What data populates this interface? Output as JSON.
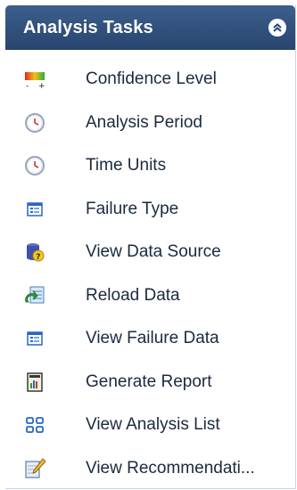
{
  "panel": {
    "title": "Analysis Tasks",
    "collapse_icon": "double-chevron-up-icon",
    "colors": {
      "header": "#2e4f7c",
      "text": "#1b2a3f"
    }
  },
  "tasks": [
    {
      "label": "Confidence Level",
      "icon": "confidence-level-icon"
    },
    {
      "label": "Analysis Period",
      "icon": "clock-icon"
    },
    {
      "label": "Time Units",
      "icon": "clock-icon"
    },
    {
      "label": "Failure Type",
      "icon": "form-icon"
    },
    {
      "label": "View Data Source",
      "icon": "data-source-icon"
    },
    {
      "label": "Reload Data",
      "icon": "reload-data-icon"
    },
    {
      "label": "View Failure Data",
      "icon": "form-icon"
    },
    {
      "label": "Generate Report",
      "icon": "report-icon"
    },
    {
      "label": "View Analysis List",
      "icon": "grid-list-icon"
    },
    {
      "label": "View Recommendati...",
      "icon": "recommendation-icon"
    }
  ]
}
